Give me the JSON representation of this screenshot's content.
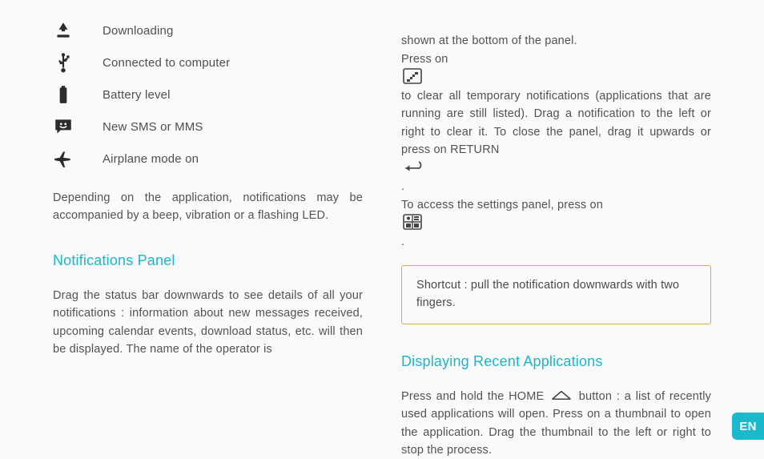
{
  "icons": [
    {
      "id": "download-icon",
      "label": "Downloading"
    },
    {
      "id": "usb-icon",
      "label": "Connected to computer"
    },
    {
      "id": "battery-icon",
      "label": "Battery level"
    },
    {
      "id": "sms-icon",
      "label": "New SMS or MMS"
    },
    {
      "id": "airplane-icon",
      "label": "Airplane mode on"
    }
  ],
  "icon_note": "Depending on the application, notifications may be accompanied by a beep, vibration or a flashing LED.",
  "left_heading": "Notifications Panel",
  "left_body": "Drag the status bar downwards to see details of all your notifications : information about new messages received, upcoming calendar events, download status, etc. will then be displayed. The name of the operator is",
  "right_p1_a": "shown at the bottom of the panel.\nPress on ",
  "right_p1_b": " to clear all temporary notifications (applications that are running are still listed). Drag a notification to the left or right to clear it. To close the panel, drag it upwards or press on RETURN ",
  "right_p1_c": ".\nTo access the settings panel, press on ",
  "right_p1_d": " .",
  "tip": "Shortcut : pull the notification downwards with two fingers.",
  "right_heading": "Displaying Recent Applications",
  "right_body_a": "Press and hold the HOME ",
  "right_body_b": " button : a list of recently used applications will open. Press on a thumbnail to open the application. Drag the thumbnail to the left or right to stop the process.",
  "lang": "EN"
}
